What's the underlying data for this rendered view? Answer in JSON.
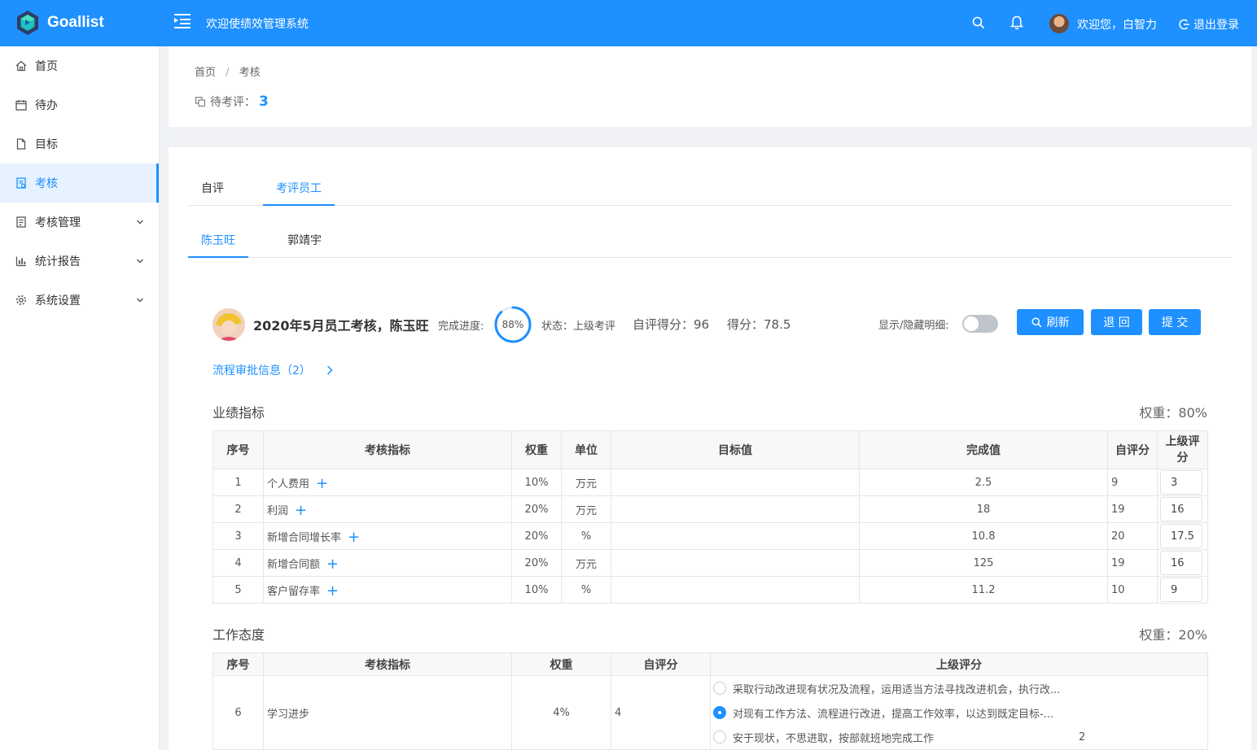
{
  "app": {
    "logo_text": "Goallist",
    "title": "欢迎使绩效管理系统",
    "welcome": "欢迎您，白智力",
    "logout": "退出登录"
  },
  "sidebar": {
    "items": [
      {
        "label": "首页"
      },
      {
        "label": "待办"
      },
      {
        "label": "目标"
      },
      {
        "label": "考核"
      },
      {
        "label": "考核管理"
      },
      {
        "label": "统计报告"
      },
      {
        "label": "系统设置"
      }
    ]
  },
  "breadcrumb": {
    "home": "首页",
    "sep": "/",
    "current": "考核"
  },
  "pending": {
    "label": "待考评：",
    "count": "3"
  },
  "tabs": {
    "self": "自评",
    "review": "考评员工"
  },
  "employee_tabs": {
    "a": "陈玉旺",
    "b": "郭靖宇"
  },
  "review": {
    "title": "2020年5月员工考核，陈玉旺",
    "progress_label": "完成进度:",
    "progress_value": "88%",
    "progress_fraction": 0.88,
    "status": "状态：上级考评",
    "self_score": "自评得分：96",
    "score": "得分：78.5",
    "toggle_label": "显示/隐藏明细:",
    "btn_refresh": "刷新",
    "btn_return": "退 回",
    "btn_submit": "提 交",
    "flow_link": "流程审批信息（2）"
  },
  "performance": {
    "title": "业绩指标",
    "weight": "权重：80%",
    "headers": {
      "no": "序号",
      "indicator": "考核指标",
      "weight": "权重",
      "unit": "单位",
      "target": "目标值",
      "actual": "完成值",
      "self": "自评分",
      "superior": "上级评分"
    },
    "rows": [
      {
        "no": "1",
        "name": "个人费用",
        "weight": "10%",
        "unit": "万元",
        "target": "",
        "actual": "2.5",
        "self": "9",
        "superior": "3"
      },
      {
        "no": "2",
        "name": "利润",
        "weight": "20%",
        "unit": "万元",
        "target": "",
        "actual": "18",
        "self": "19",
        "superior": "16"
      },
      {
        "no": "3",
        "name": "新增合同增长率",
        "weight": "20%",
        "unit": "%",
        "target": "",
        "actual": "10.8",
        "self": "20",
        "superior": "17.5"
      },
      {
        "no": "4",
        "name": "新增合同额",
        "weight": "20%",
        "unit": "万元",
        "target": "",
        "actual": "125",
        "self": "19",
        "superior": "16"
      },
      {
        "no": "5",
        "name": "客户留存率",
        "weight": "10%",
        "unit": "%",
        "target": "",
        "actual": "11.2",
        "self": "10",
        "superior": "9"
      }
    ]
  },
  "attitude": {
    "title": "工作态度",
    "weight": "权重：20%",
    "headers": {
      "no": "序号",
      "indicator": "考核指标",
      "weight": "权重",
      "self": "自评分",
      "superior": "上级评分"
    },
    "row": {
      "no": "6",
      "name": "学习进步",
      "weight": "4%",
      "self": "4",
      "options": [
        "采取行动改进现有状况及流程，运用适当方法寻找改进机会，执行改...",
        "对现有工作方法、流程进行改进，提高工作效率，以达到既定目标-...",
        "安于现状，不思进取，按部就班地完成工作"
      ],
      "selected_index": 1,
      "last_option_score": "2"
    }
  },
  "colors": {
    "primary": "#1e90ff"
  }
}
